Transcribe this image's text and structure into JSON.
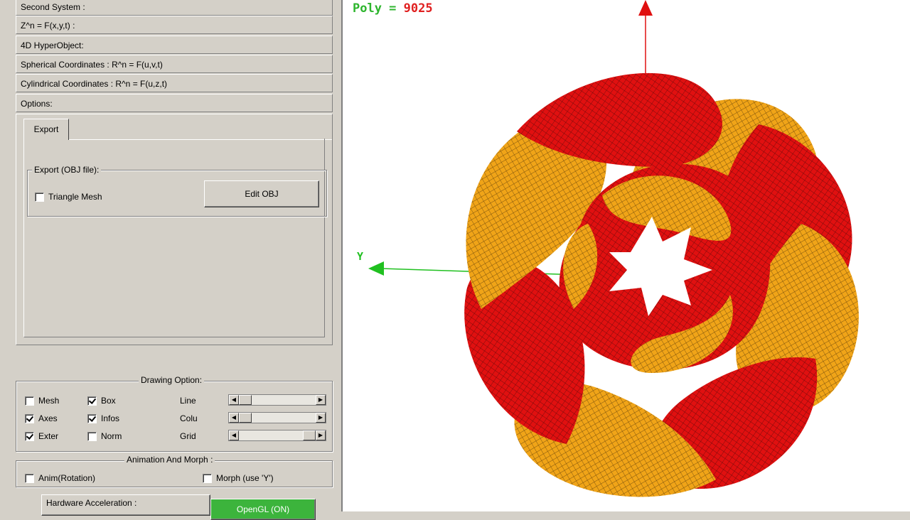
{
  "sections": [
    "Second System :",
    "Z^n = F(x,y,t) :",
    "4D HyperObject:",
    "Spherical Coordinates : R^n = F(u,v,t)",
    "Cylindrical Coordinates : R^n = F(u,z,t)",
    "Options:"
  ],
  "options": {
    "tab": "Export",
    "export_group_label": "Export (OBJ file):",
    "triangle_mesh_label": "Triangle Mesh",
    "triangle_mesh_checked": false,
    "edit_obj_label": "Edit OBJ"
  },
  "drawing": {
    "title": "Drawing Option:",
    "mesh": "Mesh",
    "mesh_checked": false,
    "box": "Box",
    "box_checked": true,
    "axes": "Axes",
    "axes_checked": true,
    "infos": "Infos",
    "infos_checked": true,
    "exter": "Exter",
    "exter_checked": true,
    "norm": "Norm",
    "norm_checked": false,
    "line": "Line",
    "colu": "Colu",
    "grid": "Grid"
  },
  "animation": {
    "title": "Animation And Morph :",
    "anim": "Anim(Rotation)",
    "anim_checked": false,
    "morph": "Morph (use 'Y')",
    "morph_checked": false
  },
  "hardware": {
    "label": "Hardware Acceleration :",
    "opengl": "OpenGL (ON)",
    "opengl_color": "#3cb43c"
  },
  "viewport": {
    "poly_key": "Poly =",
    "poly_value": "9025",
    "axis_y": "Y",
    "color_red": "#e01010",
    "color_gold": "#f0a418"
  }
}
